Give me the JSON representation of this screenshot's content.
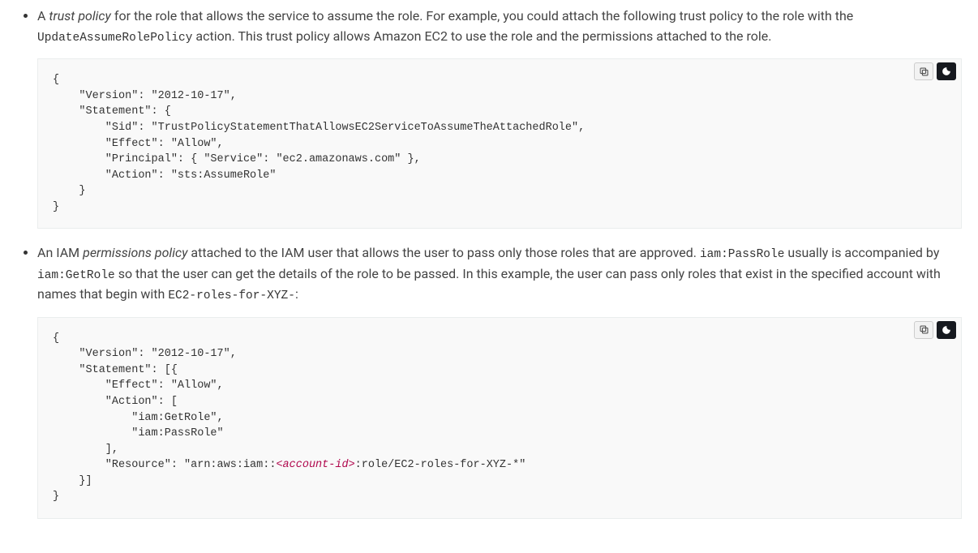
{
  "bullet1": {
    "prefix": "A ",
    "emphasis": "trust policy",
    "segment1": " for the role that allows the service to assume the role. For example, you could attach the following trust policy to the role with the ",
    "code1": "UpdateAssumeRolePolicy",
    "segment2": " action. This trust policy allows Amazon EC2 to use the role and the permissions attached to the role."
  },
  "code_block1": "{\n    \"Version\": \"2012-10-17\",\n    \"Statement\": {\n        \"Sid\": \"TrustPolicyStatementThatAllowsEC2ServiceToAssumeTheAttachedRole\",\n        \"Effect\": \"Allow\",\n        \"Principal\": { \"Service\": \"ec2.amazonaws.com\" },\n        \"Action\": \"sts:AssumeRole\"\n    }\n}",
  "bullet2": {
    "segment1": "An IAM ",
    "emphasis": "permissions policy",
    "segment2": " attached to the IAM user that allows the user to pass only those roles that are approved. ",
    "code1": "iam:PassRole",
    "segment3": " usually is accompanied by ",
    "code2": "iam:GetRole",
    "segment4": " so that the user can get the details of the role to be passed. In this example, the user can pass only roles that exist in the specified account with names that begin with ",
    "code3": "EC2-roles-for-XYZ-",
    "segment5": ":"
  },
  "code_block2": {
    "pre": "{\n    \"Version\": \"2012-10-17\",\n    \"Statement\": [{\n        \"Effect\": \"Allow\",\n        \"Action\": [\n            \"iam:GetRole\",\n            \"iam:PassRole\"\n        ],\n        \"Resource\": \"arn:aws:iam::",
    "replaceable": "<account-id>",
    "post": ":role/EC2-roles-for-XYZ-*\"\n    }]\n}"
  },
  "icons": {
    "copy": "copy-icon",
    "dark": "dark-mode-icon"
  }
}
